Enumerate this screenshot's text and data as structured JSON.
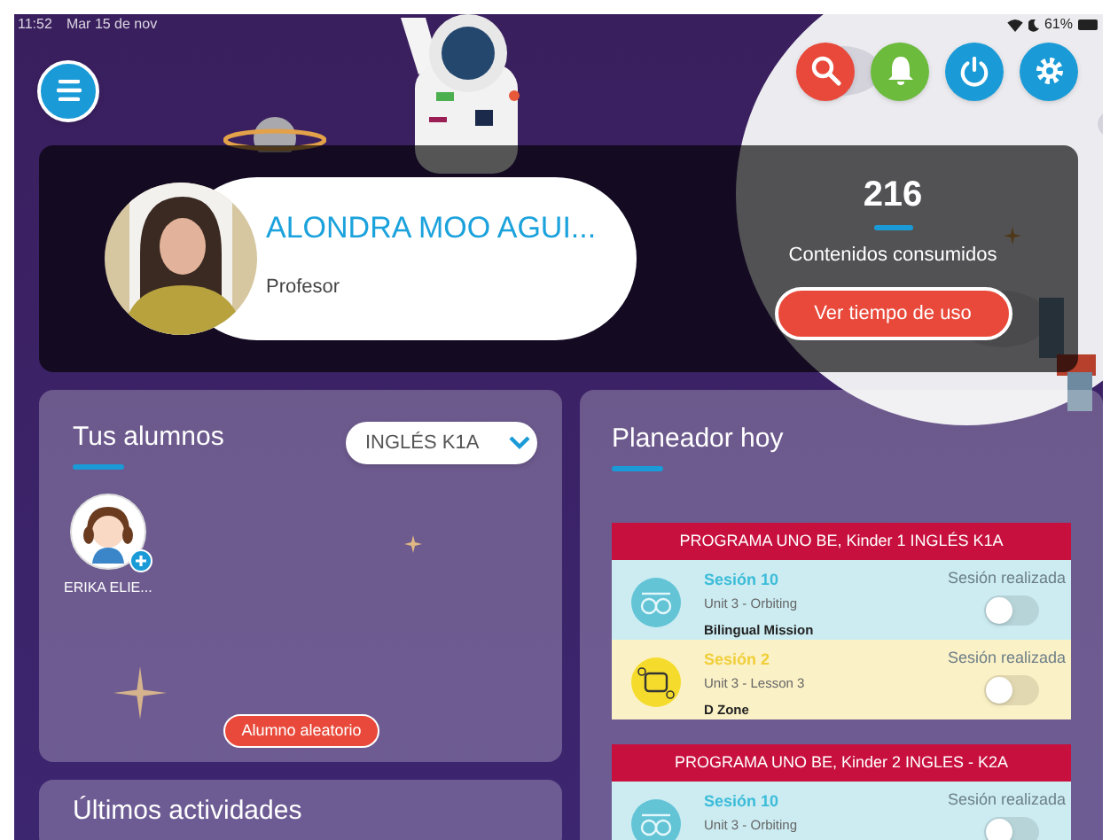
{
  "status_bar": {
    "time": "11:52",
    "date": "Mar 15 de nov",
    "battery": "61%"
  },
  "profile": {
    "name": "ALONDRA MOO AGUI...",
    "role": "Profesor",
    "count": "216",
    "count_label": "Contenidos consumidos",
    "button": "Ver tiempo de uso"
  },
  "students_card": {
    "title": "Tus alumnos",
    "group_select": "INGLÉS K1A",
    "students": [
      {
        "name": "ERIKA ELIE..."
      }
    ],
    "button": "Alumno aleatorio"
  },
  "planner": {
    "title": "Planeador hoy",
    "programs": [
      {
        "header": "PROGRAMA UNO BE, Kinder 1 INGLÉS K1A",
        "sessions": [
          {
            "kind": "blm",
            "session": "Sesión 10",
            "unit": "Unit 3 - Orbiting",
            "product": "Bilingual Mission",
            "status_label": "Sesión realizada",
            "done": false
          },
          {
            "kind": "dz",
            "session": "Sesión 2",
            "unit": "Unit 3 - Lesson 3",
            "product": "D Zone",
            "status_label": "Sesión realizada",
            "done": false
          }
        ]
      },
      {
        "header": "PROGRAMA UNO BE, Kinder 2 INGLES - K2A",
        "sessions": [
          {
            "kind": "blm",
            "session": "Sesión 10",
            "unit": "Unit 3 - Orbiting",
            "status_label": "Sesión realizada",
            "done": false
          }
        ]
      }
    ]
  },
  "activities_card": {
    "title": "Últimos actividades"
  }
}
